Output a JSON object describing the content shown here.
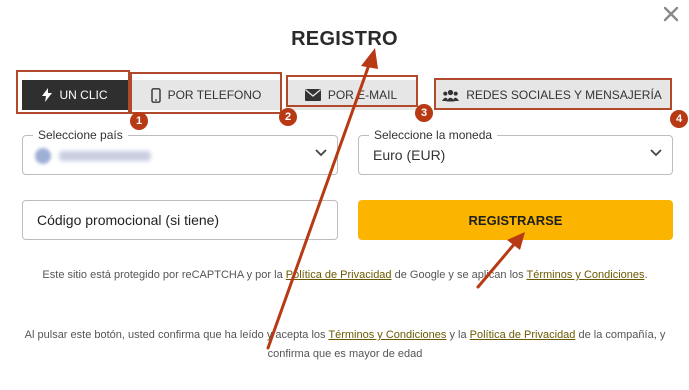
{
  "title": "REGISTRO",
  "tabs": [
    {
      "label": "UN CLIC",
      "icon": "bolt-icon"
    },
    {
      "label": "POR TELEFONO",
      "icon": "phone-icon"
    },
    {
      "label": "POR E-MAIL",
      "icon": "envelope-icon"
    },
    {
      "label": "REDES SOCIALES Y MENSAJERÍA",
      "icon": "users-icon"
    }
  ],
  "badges": [
    "1",
    "2",
    "3",
    "4"
  ],
  "country": {
    "label": "Seleccione país",
    "value": "Country (blurred)"
  },
  "currency": {
    "label": "Seleccione la moneda",
    "value": "Euro (EUR)"
  },
  "promo": {
    "placeholder": "Código promocional (si tiene)"
  },
  "submit_label": "REGISTRARSE",
  "recaptcha": {
    "prefix": "Este sitio está protegido por reCAPTCHA y por la",
    "privacy_link": "Política de Privacidad",
    "middle": "de Google y se aplican los",
    "terms_link": "Términos y Condiciones",
    "suffix": "."
  },
  "consent": {
    "prefix": "Al pulsar este botón, usted confirma que ha leído y acepta los",
    "terms_link": "Términos y Condiciones",
    "middle": "y la",
    "privacy_link": "Política de Privacidad",
    "suffix": "de la compañía, y confirma que es mayor de edad"
  },
  "colors": {
    "accent": "#fbb500",
    "annotation": "#b73a14",
    "active_tab": "#2f2f2f"
  }
}
